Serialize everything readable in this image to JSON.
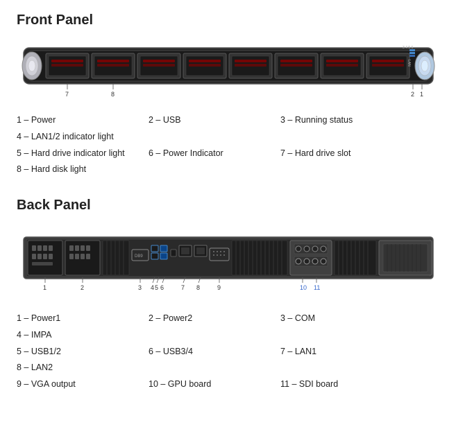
{
  "frontPanel": {
    "title": "Front Panel",
    "legend": [
      {
        "num": "1",
        "label": "Power"
      },
      {
        "num": "2",
        "label": "USB"
      },
      {
        "num": "3",
        "label": "Running status"
      },
      {
        "num": "4",
        "label": "LAN1/2 indicator light"
      },
      {
        "num": "5",
        "label": "Hard drive indicator light"
      },
      {
        "num": "6",
        "label": "Power Indicator"
      },
      {
        "num": "7",
        "label": "Hard drive slot"
      },
      {
        "num": "8",
        "label": "Hard disk light"
      }
    ]
  },
  "backPanel": {
    "title": "Back Panel",
    "legend": [
      {
        "num": "1",
        "label": "Power1"
      },
      {
        "num": "2",
        "label": "Power2"
      },
      {
        "num": "3",
        "label": "COM"
      },
      {
        "num": "4",
        "label": "IMPA"
      },
      {
        "num": "5",
        "label": "USB1/2"
      },
      {
        "num": "6",
        "label": "USB3/4"
      },
      {
        "num": "7",
        "label": "LAN1"
      },
      {
        "num": "8",
        "label": "LAN2"
      },
      {
        "num": "9",
        "label": "VGA output"
      },
      {
        "num": "10",
        "label": "GPU board"
      },
      {
        "num": "11",
        "label": "SDI board"
      }
    ]
  }
}
